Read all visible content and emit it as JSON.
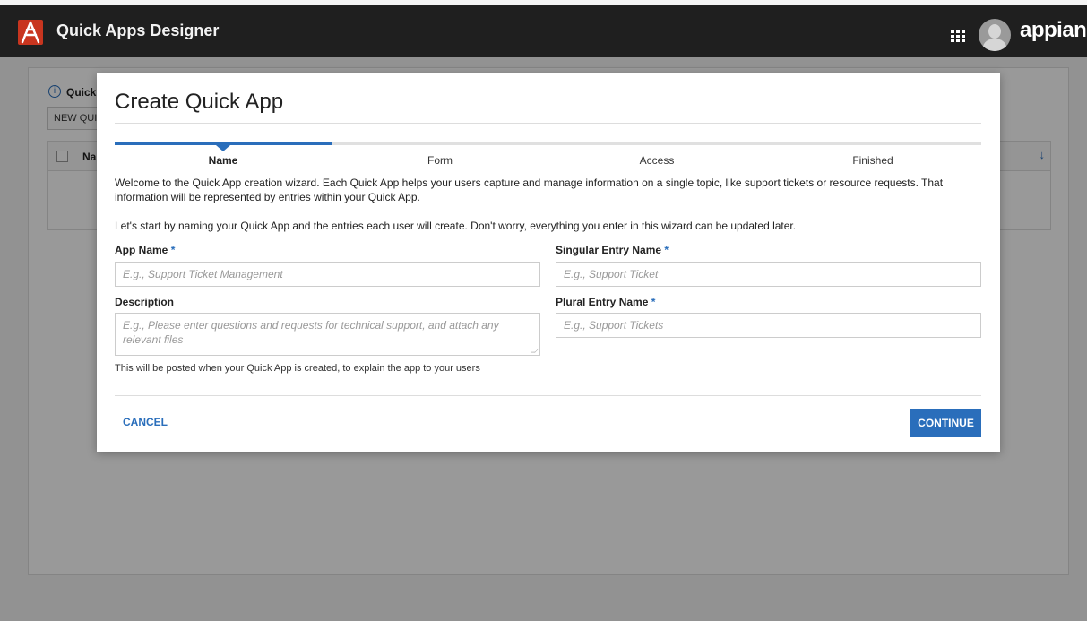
{
  "header": {
    "title": "Quick Apps Designer",
    "brand": "appian",
    "logo_icon": "appian-logo-icon",
    "apps_icon": "grid-icon",
    "avatar_icon": "user-avatar-icon"
  },
  "background_page": {
    "section_title": "Quick",
    "new_button_label": "NEW QUI",
    "grid_header_name": "Na"
  },
  "dialog": {
    "title": "Create Quick App",
    "steps": [
      {
        "label": "Name",
        "active": true
      },
      {
        "label": "Form",
        "active": false
      },
      {
        "label": "Access",
        "active": false
      },
      {
        "label": "Finished",
        "active": false
      }
    ],
    "intro": "Welcome to the Quick App creation wizard. Each Quick App helps your users capture and manage information on a single topic, like support tickets or resource requests. That information will be represented by entries within your Quick App.",
    "instructions": "Let's start by naming your Quick App and the entries each user will create. Don't worry, everything you enter in this wizard can be updated later.",
    "fields": {
      "app_name": {
        "label": "App Name",
        "required_mark": "*",
        "value": "",
        "placeholder": "E.g., Support Ticket Management"
      },
      "description": {
        "label": "Description",
        "value": "",
        "placeholder": "E.g., Please enter questions and requests for technical support, and attach any relevant files",
        "helper": "This will be posted when your Quick App is created, to explain the app to your users"
      },
      "singular_entry_name": {
        "label": "Singular Entry Name",
        "required_mark": "*",
        "value": "",
        "placeholder": "E.g., Support Ticket"
      },
      "plural_entry_name": {
        "label": "Plural Entry Name",
        "required_mark": "*",
        "value": "",
        "placeholder": "E.g., Support Tickets"
      }
    },
    "cancel_label": "CANCEL",
    "continue_label": "CONTINUE"
  },
  "colors": {
    "accent": "#2a6ebb",
    "topbar": "#1f1f1f",
    "logo": "#c8351f"
  }
}
